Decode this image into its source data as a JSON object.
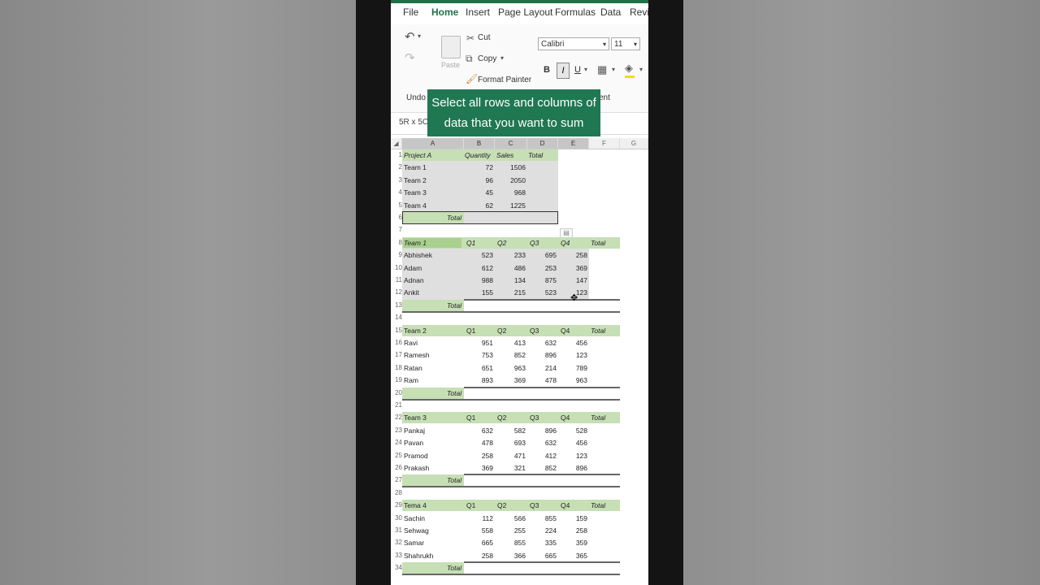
{
  "ribbon": {
    "tabs": [
      "File",
      "Home",
      "Insert",
      "Page Layout",
      "Formulas",
      "Data",
      "Revie"
    ],
    "active_tab": "Home",
    "undo_label": "Undo",
    "paste_label": "Paste",
    "cut_label": "Cut",
    "copy_label": "Copy",
    "format_painter_label": "Format Painter",
    "font_name": "Calibri",
    "font_size": "11",
    "bold_label": "B",
    "italic_label": "I",
    "underline_label": "U",
    "alignment_group_fragment": "ent"
  },
  "tooltip": {
    "line1": "Select all rows and columns of",
    "line2": "data that you want to sum"
  },
  "formula_bar": {
    "name_box": "5R x 5C"
  },
  "columns": [
    "A",
    "B",
    "C",
    "D",
    "E",
    "F",
    "G"
  ],
  "row_numbers": [
    "1",
    "2",
    "3",
    "4",
    "5",
    "6",
    "7",
    "8",
    "9",
    "10",
    "11",
    "12",
    "13",
    "14",
    "15",
    "16",
    "17",
    "18",
    "19",
    "20",
    "21",
    "22",
    "23",
    "24",
    "25",
    "26",
    "27",
    "28",
    "29",
    "30",
    "31",
    "32",
    "33",
    "34"
  ],
  "project_table": {
    "headers": [
      "Project A",
      "Quantity",
      "Sales",
      "Total"
    ],
    "rows": [
      {
        "name": "Team 1",
        "qty": "72",
        "sales": "1506"
      },
      {
        "name": "Team 2",
        "qty": "96",
        "sales": "2050"
      },
      {
        "name": "Team 3",
        "qty": "45",
        "sales": "968"
      },
      {
        "name": "Team 4",
        "qty": "62",
        "sales": "1225"
      }
    ],
    "total_label": "Total"
  },
  "team_tables": [
    {
      "title": "Team 1",
      "quarters": [
        "Q1",
        "Q2",
        "Q3",
        "Q4"
      ],
      "total_label": "Total",
      "rows": [
        {
          "name": "Abhishek",
          "q": [
            "523",
            "233",
            "695",
            "258"
          ]
        },
        {
          "name": "Adam",
          "q": [
            "612",
            "486",
            "253",
            "369"
          ]
        },
        {
          "name": "Adnan",
          "q": [
            "988",
            "134",
            "875",
            "147"
          ]
        },
        {
          "name": "Ankit",
          "q": [
            "155",
            "215",
            "523",
            "123"
          ]
        }
      ]
    },
    {
      "title": "Team 2",
      "quarters": [
        "Q1",
        "Q2",
        "Q3",
        "Q4"
      ],
      "total_label": "Total",
      "rows": [
        {
          "name": "Ravi",
          "q": [
            "951",
            "413",
            "632",
            "456"
          ]
        },
        {
          "name": "Ramesh",
          "q": [
            "753",
            "852",
            "896",
            "123"
          ]
        },
        {
          "name": "Ratan",
          "q": [
            "651",
            "963",
            "214",
            "789"
          ]
        },
        {
          "name": "Ram",
          "q": [
            "893",
            "369",
            "478",
            "963"
          ]
        }
      ]
    },
    {
      "title": "Team 3",
      "quarters": [
        "Q1",
        "Q2",
        "Q3",
        "Q4"
      ],
      "total_label": "Total",
      "rows": [
        {
          "name": "Pankaj",
          "q": [
            "632",
            "582",
            "896",
            "528"
          ]
        },
        {
          "name": "Pavan",
          "q": [
            "478",
            "693",
            "632",
            "456"
          ]
        },
        {
          "name": "Pramod",
          "q": [
            "258",
            "471",
            "412",
            "123"
          ]
        },
        {
          "name": "Prakash",
          "q": [
            "369",
            "321",
            "852",
            "896"
          ]
        }
      ]
    },
    {
      "title": "Tema 4",
      "quarters": [
        "Q1",
        "Q2",
        "Q3",
        "Q4"
      ],
      "total_label": "Total",
      "rows": [
        {
          "name": "Sachin",
          "q": [
            "112",
            "566",
            "855",
            "159"
          ]
        },
        {
          "name": "Sehwag",
          "q": [
            "558",
            "255",
            "224",
            "258"
          ]
        },
        {
          "name": "Samar",
          "q": [
            "665",
            "855",
            "335",
            "359"
          ]
        },
        {
          "name": "Shahrukh",
          "q": [
            "258",
            "366",
            "665",
            "365"
          ]
        }
      ]
    }
  ]
}
